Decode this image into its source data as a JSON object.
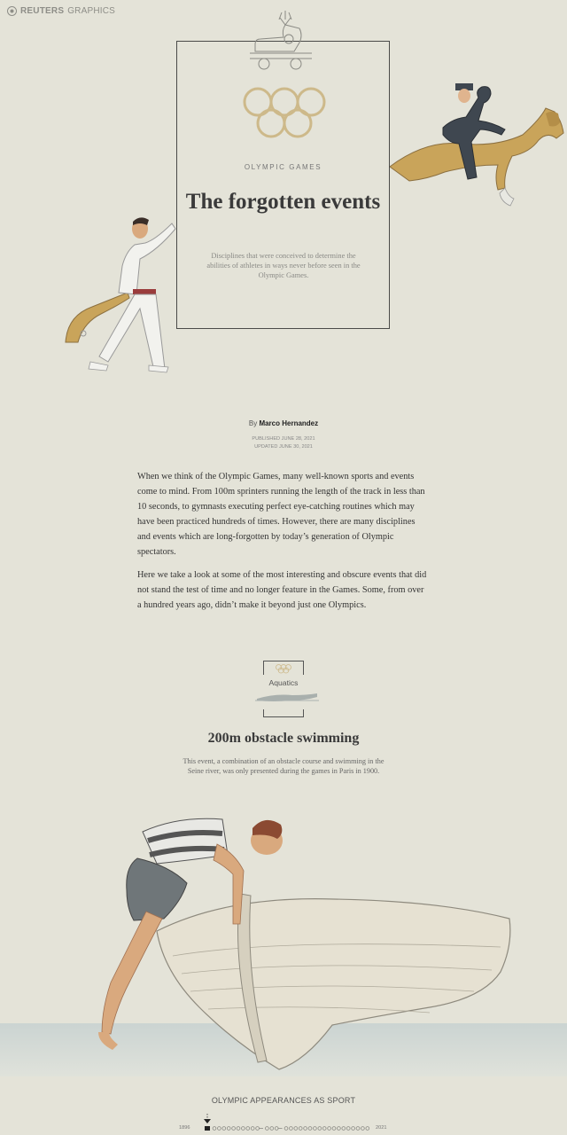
{
  "header": {
    "brand": "REUTERS",
    "section": "GRAPHICS"
  },
  "hero": {
    "kicker": "OLYMPIC GAMES",
    "title": "The forgotten events",
    "subtitle": "Disciplines that were conceived to determine the abilities of athletes in ways never before seen in the Olympic Games."
  },
  "byline": {
    "prefix": "By",
    "author": "Marco Hernandez",
    "published": "PUBLISHED JUNE 28, 2021",
    "updated": "UPDATED JUNE 30, 2021"
  },
  "intro": {
    "p1": "When we think of the Olympic Games, many well-known sports and events come to mind. From 100m sprinters running the length of the track in less than 10 seconds, to gymnasts executing perfect eye-catching routines which may have been practiced hundreds of times. However, there are many disciplines and events which are long-forgotten by today’s generation of Olympic spectators.",
    "p2": "Here we take a look at some of the most interesting and obscure events that did not stand the test of time and no longer feature in the Games. Some, from over a hundred years ago, didn’t make it beyond just one Olympics."
  },
  "event": {
    "category": "Aquatics",
    "title": "200m obstacle swimming",
    "description": "This event, a combination of an obstacle course and swimming in the Seine river, was only presented during the games in Paris in 1900."
  },
  "timeline": {
    "title": "OLYMPIC APPEARANCES AS SPORT",
    "start_year": "1896",
    "end_year": "2021",
    "highlight_index": 0
  },
  "colors": {
    "background": "#e4e3d8",
    "rings": "#cdb98a",
    "horse": "#c9a45a",
    "water": "#c8d2d1"
  },
  "illustrations": [
    "reindeer-cart-icon",
    "olympic-rings-icon",
    "jai-alai-player",
    "equestrian-rider",
    "swimmer-boat",
    "swimmer-small-icon"
  ]
}
